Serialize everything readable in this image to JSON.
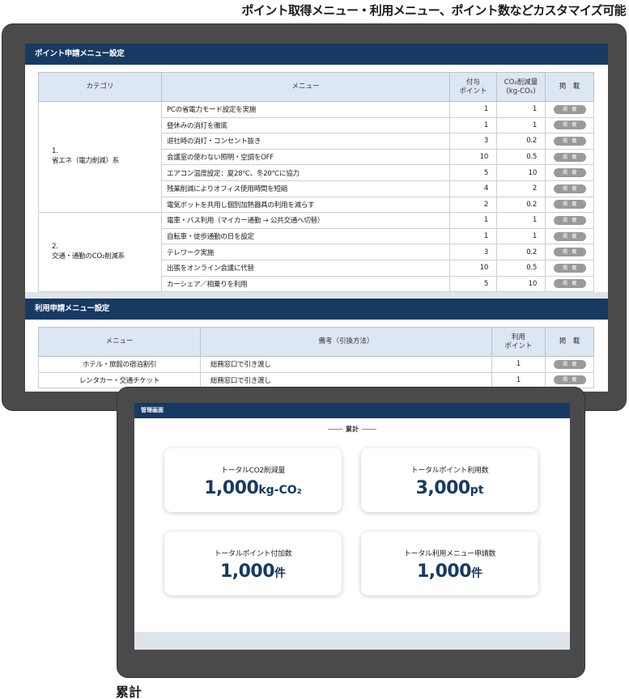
{
  "caption_top": "ポイント取得メニュー・利用メニュー、ポイント数などカスタマイズ可能",
  "caption_bottom": "累計",
  "point_menu": {
    "title": "ポイント申請メニュー設定",
    "headers": {
      "category": "カテゴリ",
      "menu": "メニュー",
      "points": "付与\nポイント",
      "co2": "CO₂削減量\n(kg-CO₂)",
      "publish": "掲　載"
    },
    "categories": [
      {
        "label": "1.\n省エネ（電力削減）系",
        "rows": [
          {
            "menu": "PCの省電力モード設定を実施",
            "points": "1",
            "co2": "1"
          },
          {
            "menu": "昼休みの消灯を徹底",
            "points": "1",
            "co2": "1"
          },
          {
            "menu": "退社時の消灯・コンセント抜き",
            "points": "3",
            "co2": "0.2"
          },
          {
            "menu": "会議室の使わない照明・空調をOFF",
            "points": "10",
            "co2": "0.5"
          },
          {
            "menu": "エアコン温度設定：夏28℃、冬20℃に協力",
            "points": "5",
            "co2": "10"
          },
          {
            "menu": "残業削減によりオフィス使用時間を短縮",
            "points": "4",
            "co2": "2"
          },
          {
            "menu": "電気ポットを共用し個別加熱器具の利用を減らす",
            "points": "2",
            "co2": "0.2"
          }
        ]
      },
      {
        "label": "2.\n交通・通勤のCO₂削減系",
        "rows": [
          {
            "menu": "電車・バス利用（マイカー通勤 → 公共交通へ切替）",
            "points": "1",
            "co2": "1"
          },
          {
            "menu": "自転車・徒歩通勤の日を設定",
            "points": "1",
            "co2": "1"
          },
          {
            "menu": "テレワーク実施",
            "points": "3",
            "co2": "0.2"
          },
          {
            "menu": "出張をオンライン会議に代替",
            "points": "10",
            "co2": "0.5"
          },
          {
            "menu": "カーシェア／相乗りを利用",
            "points": "5",
            "co2": "10"
          }
        ]
      }
    ],
    "publish_btn": "掲　載"
  },
  "use_menu": {
    "title": "利用申請メニュー設定",
    "headers": {
      "menu": "メニュー",
      "note": "備考（引換方法）",
      "points": "利用\nポイント",
      "publish": "掲　載"
    },
    "rows": [
      {
        "menu": "ホテル・旅館の宿泊割引",
        "note": "総務窓口で引き渡し",
        "points": "1"
      },
      {
        "menu": "レンタカー・交通チケット",
        "note": "総務窓口で引き渡し",
        "points": "1"
      }
    ],
    "publish_btn": "掲　載"
  },
  "admin": {
    "title": "管理画面",
    "section": "累計",
    "cards": [
      {
        "label": "トータルCO2削減量",
        "value": "1,000",
        "unit": "kg-CO₂"
      },
      {
        "label": "トータルポイント利用数",
        "value": "3,000",
        "unit": "pt"
      },
      {
        "label": "トータルポイント付加数",
        "value": "1,000",
        "unit": "件"
      },
      {
        "label": "トータル利用メニュー申請数",
        "value": "1,000",
        "unit": "件"
      }
    ]
  }
}
